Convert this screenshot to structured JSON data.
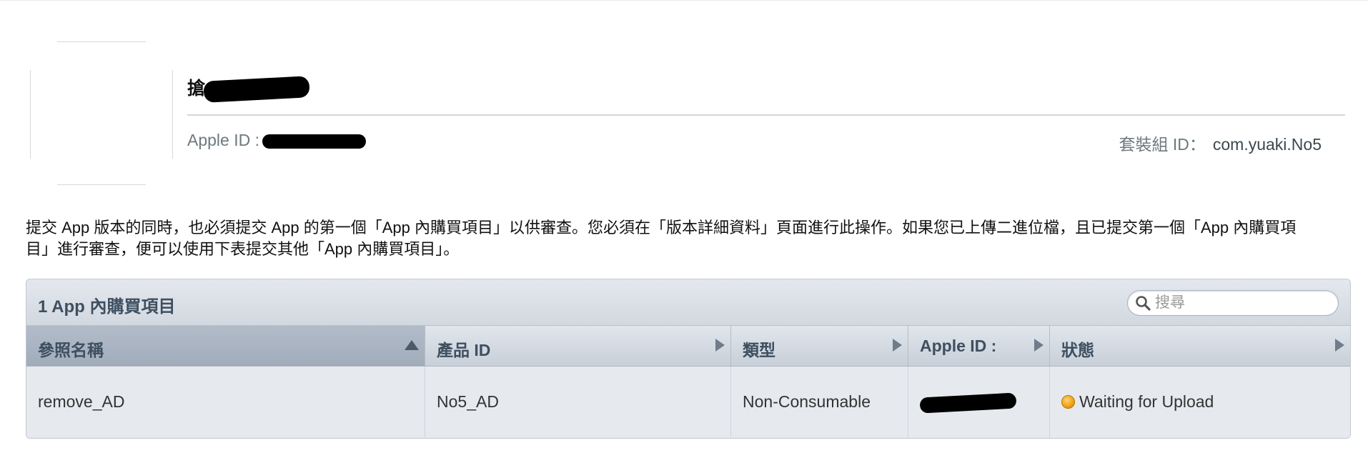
{
  "app": {
    "name": "搶",
    "apple_id_label": "Apple ID :",
    "bundle_id_label": "套裝組 ID：",
    "bundle_id_value": "com.yuaki.No5"
  },
  "description": "提交 App 版本的同時，也必須提交 App 的第一個「App 內購買項目」以供審查。您必須在「版本詳細資料」頁面進行此操作。如果您已上傳二進位檔，且已提交第一個「App 內購買項目」進行審查，便可以使用下表提交其他「App 內購買項目」。",
  "table": {
    "title": "1 App 內購買項目",
    "search_placeholder": "搜尋",
    "columns": [
      {
        "label": "參照名稱",
        "sort": "ascending"
      },
      {
        "label": "產品 ID"
      },
      {
        "label": "類型"
      },
      {
        "label": "Apple ID :"
      },
      {
        "label": "狀態"
      }
    ],
    "rows": [
      {
        "reference_name": "remove_AD",
        "product_id": "No5_AD",
        "type": "Non-Consumable",
        "apple_id": "",
        "status": "Waiting for Upload",
        "status_color": "#f0a010"
      }
    ]
  },
  "icons": [
    "app-icon-placeholder",
    "search-icon",
    "sort-ascending-icon",
    "sort-arrow-icon",
    "status-dot-icon"
  ],
  "colors": {
    "header_text": "#3e4f60",
    "meta_text": "#6c7a7f",
    "status_pending": "#f0a010"
  }
}
